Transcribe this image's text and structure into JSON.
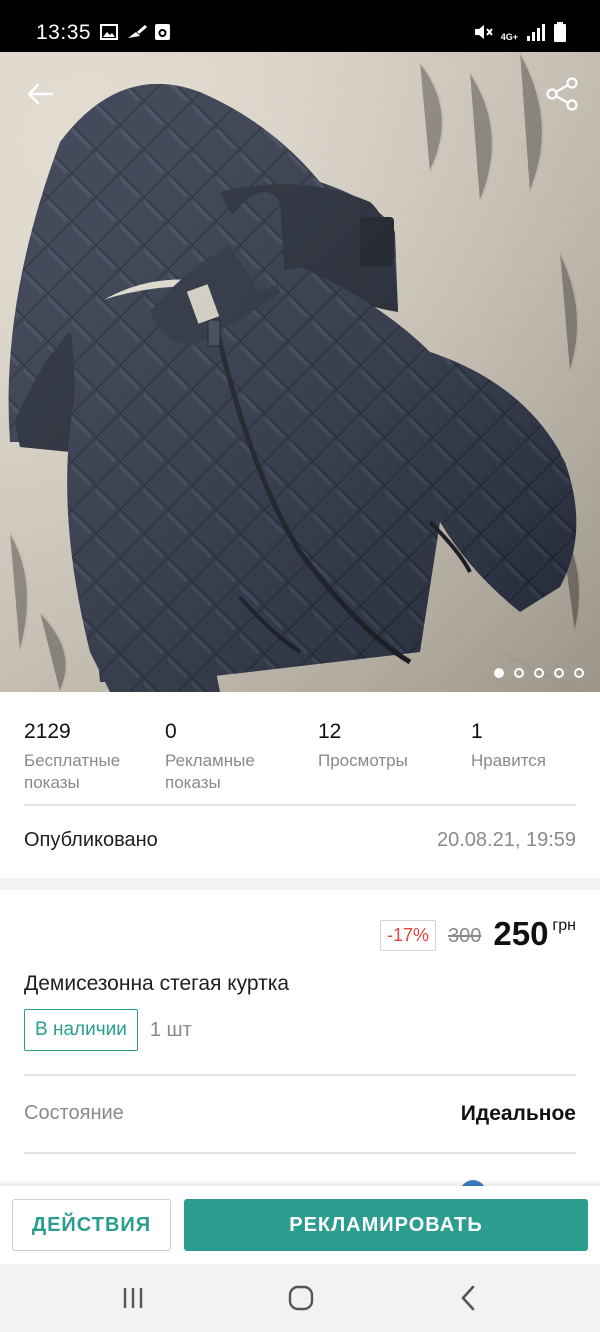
{
  "status_bar": {
    "time": "13:35",
    "network": "4G+",
    "icons": [
      "gallery-icon",
      "broom-icon",
      "camera-box-icon",
      "mute-icon",
      "signal-icon",
      "battery-icon"
    ]
  },
  "hero": {
    "photo_subject": "jacket-photo",
    "gallery_count": 5,
    "gallery_active_index": 0
  },
  "stats": [
    {
      "value": "2129",
      "label": "Бесплатные показы"
    },
    {
      "value": "0",
      "label": "Рекламные показы"
    },
    {
      "value": "12",
      "label": "Просмотры"
    },
    {
      "value": "1",
      "label": "Нравится"
    }
  ],
  "published": {
    "label": "Опубликовано",
    "date": "20.08.21, 19:59"
  },
  "price": {
    "discount": "-17%",
    "old": "300",
    "current": "250",
    "currency": "грн"
  },
  "listing": {
    "title": "Демисезонна стегая куртка",
    "stock_label": "В наличии",
    "quantity": "1 шт"
  },
  "condition": {
    "label": "Состояние",
    "value": "Идеальное"
  },
  "actions": {
    "secondary": "ДЕЙСТВИЯ",
    "primary": "РЕКЛАМИРОВАТЬ"
  },
  "colors": {
    "accent": "#2a9d8f",
    "discount": "#e0443a",
    "muted": "#8a8a8a"
  }
}
